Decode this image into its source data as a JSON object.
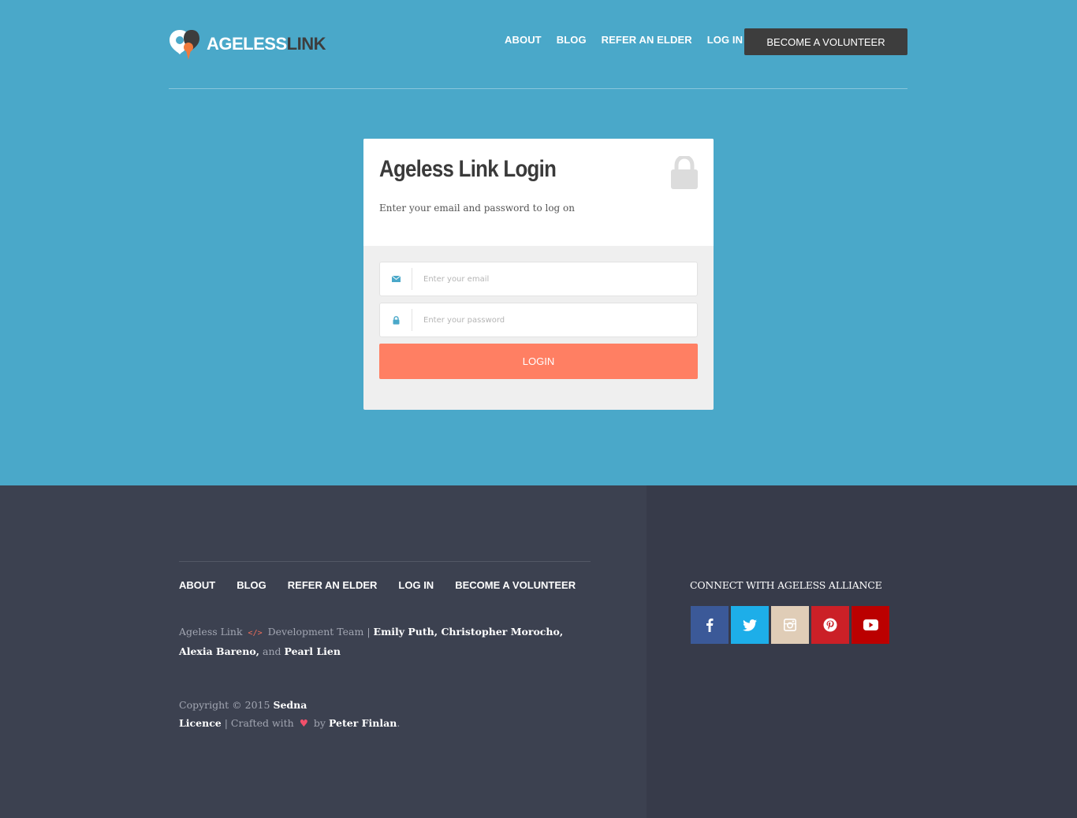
{
  "header": {
    "logo": {
      "part1": "AGELESS",
      "part2": "LINK",
      "icon": "heart-pin-logo-icon"
    },
    "nav": [
      {
        "label": "ABOUT"
      },
      {
        "label": "BLOG"
      },
      {
        "label": "REFER AN ELDER"
      },
      {
        "label": "LOG IN"
      }
    ],
    "cta_label": "BECOME A VOLUNTEER"
  },
  "login": {
    "title": "Ageless Link Login",
    "subtitle": "Enter your email and password to log on",
    "lock_icon": "lock-icon",
    "email_icon": "envelope-icon",
    "email_placeholder": "Enter your email",
    "email_value": "",
    "password_icon": "lock-icon",
    "password_placeholder": "Enter your password",
    "password_value": "",
    "button_label": "LOGIN"
  },
  "footer": {
    "nav": [
      {
        "label": "ABOUT"
      },
      {
        "label": "BLOG"
      },
      {
        "label": "REFER AN ELDER"
      },
      {
        "label": "LOG IN"
      },
      {
        "label": "BECOME A VOLUNTEER"
      }
    ],
    "credits_prefix": "Ageless Link",
    "code_glyph": "</>",
    "credits_mid": "Development Team |",
    "credits_names": "Emily Puth, Christopher Morocho, Alexia Bareno,",
    "credits_and": "and",
    "credits_last": "Pearl Lien",
    "copyright_text": "Copyright © 2015",
    "copyright_brand": "Sedna",
    "licence_label": "Licence",
    "crafted_text": "| Crafted with",
    "heart_glyph": "♥",
    "by_text": "by",
    "author": "Peter Finlan",
    "period": ".",
    "connect_title": "CONNECT WITH AGELESS ALLIANCE",
    "social": [
      {
        "name": "facebook",
        "icon": "facebook-icon",
        "color": "#3b5998"
      },
      {
        "name": "twitter",
        "icon": "twitter-icon",
        "color": "#1daee9"
      },
      {
        "name": "instagram",
        "icon": "instagram-icon",
        "color": "#e0cdb7"
      },
      {
        "name": "pinterest",
        "icon": "pinterest-icon",
        "color": "#cb2027"
      },
      {
        "name": "youtube",
        "icon": "youtube-icon",
        "color": "#b00"
      }
    ]
  },
  "colors": {
    "hero_bg": "#4aa8c9",
    "cta_bg": "#3d3d3d",
    "login_button": "#ff7f63",
    "footer_left": "#3c4150",
    "footer_right": "#373b4a"
  }
}
